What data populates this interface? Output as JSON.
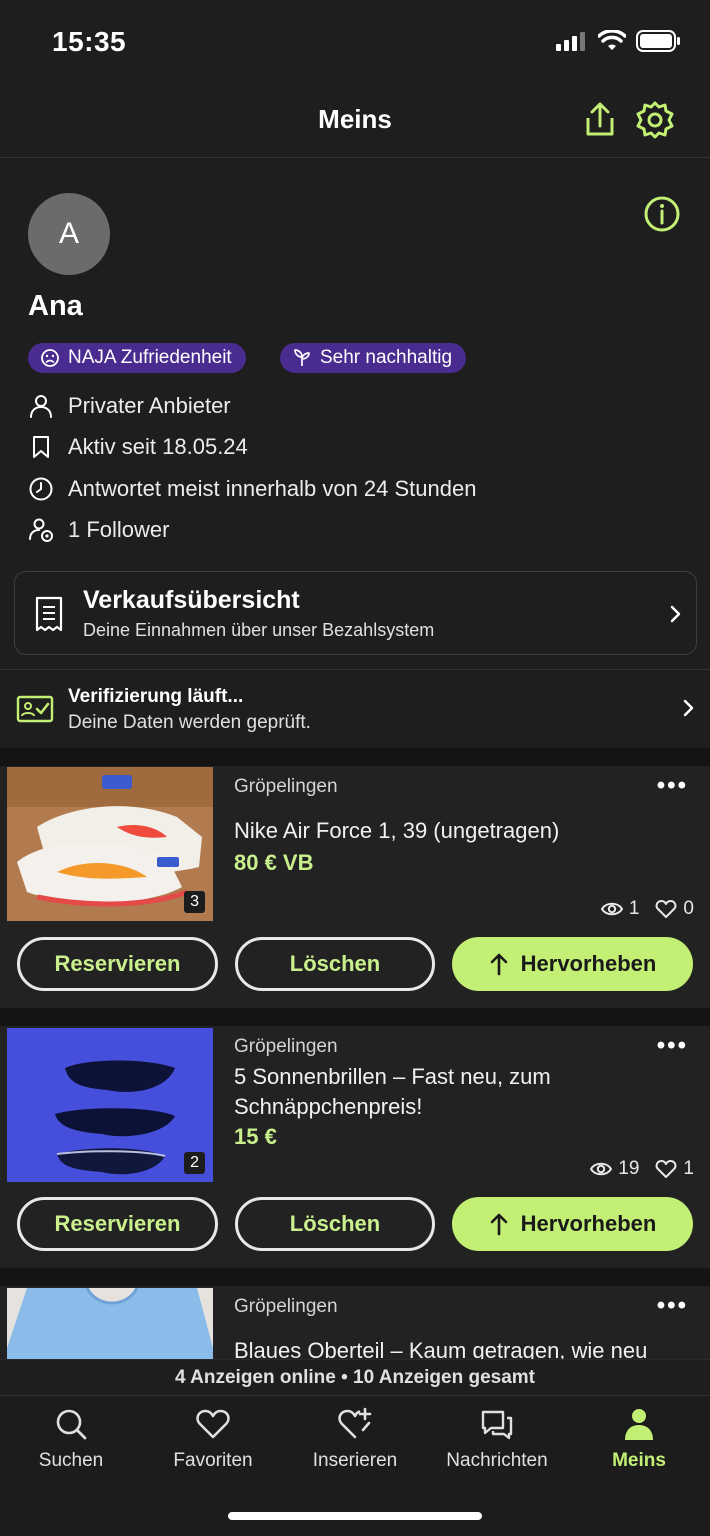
{
  "status_bar": {
    "time": "15:35"
  },
  "header": {
    "title": "Meins",
    "share_icon": "share-icon",
    "settings_icon": "gear-icon"
  },
  "profile": {
    "avatar_initial": "A",
    "name": "Ana",
    "badges": [
      {
        "label": "NAJA Zufriedenheit",
        "icon": "smiley-icon"
      },
      {
        "label": "Sehr nachhaltig",
        "icon": "leaf-icon"
      }
    ],
    "details": [
      {
        "icon": "person-icon",
        "text": "Privater Anbieter"
      },
      {
        "icon": "bookmark-icon",
        "text": "Aktiv seit 18.05.24"
      },
      {
        "icon": "clock-icon",
        "text": "Antwortet meist innerhalb von 24 Stunden"
      },
      {
        "icon": "follower-icon",
        "text": "1 Follower"
      }
    ]
  },
  "sales_card": {
    "title": "Verkaufsübersicht",
    "subtitle": "Deine Einnahmen über unser Bezahlsystem"
  },
  "verification": {
    "title": "Verifizierung läuft...",
    "subtitle": "Deine Daten werden geprüft."
  },
  "listings": [
    {
      "location": "Gröpelingen",
      "title": "Nike Air Force 1, 39 (ungetragen)",
      "price": "80 € VB",
      "image_count": "3",
      "views": "1",
      "likes": "0",
      "actions": {
        "reserve": "Reservieren",
        "delete": "Löschen",
        "highlight": "Hervorheben"
      }
    },
    {
      "location": "Gröpelingen",
      "title": "5 Sonnenbrillen – Fast neu, zum Schnäppchenpreis!",
      "price": "15 €",
      "image_count": "2",
      "views": "19",
      "likes": "1",
      "actions": {
        "reserve": "Reservieren",
        "delete": "Löschen",
        "highlight": "Hervorheben"
      }
    },
    {
      "location": "Gröpelingen",
      "title": "Blaues Oberteil – Kaum getragen, wie neu"
    }
  ],
  "summary": "4 Anzeigen online • 10 Anzeigen gesamt",
  "tabs": [
    {
      "label": "Suchen",
      "icon": "search-icon"
    },
    {
      "label": "Favoriten",
      "icon": "heart-icon"
    },
    {
      "label": "Inserieren",
      "icon": "heart-plus-icon"
    },
    {
      "label": "Nachrichten",
      "icon": "chat-icon"
    },
    {
      "label": "Meins",
      "icon": "user-icon",
      "active": true
    }
  ],
  "colors": {
    "accent": "#c2ef74",
    "badge": "#4a2b8f",
    "background": "#1e1e1e"
  }
}
